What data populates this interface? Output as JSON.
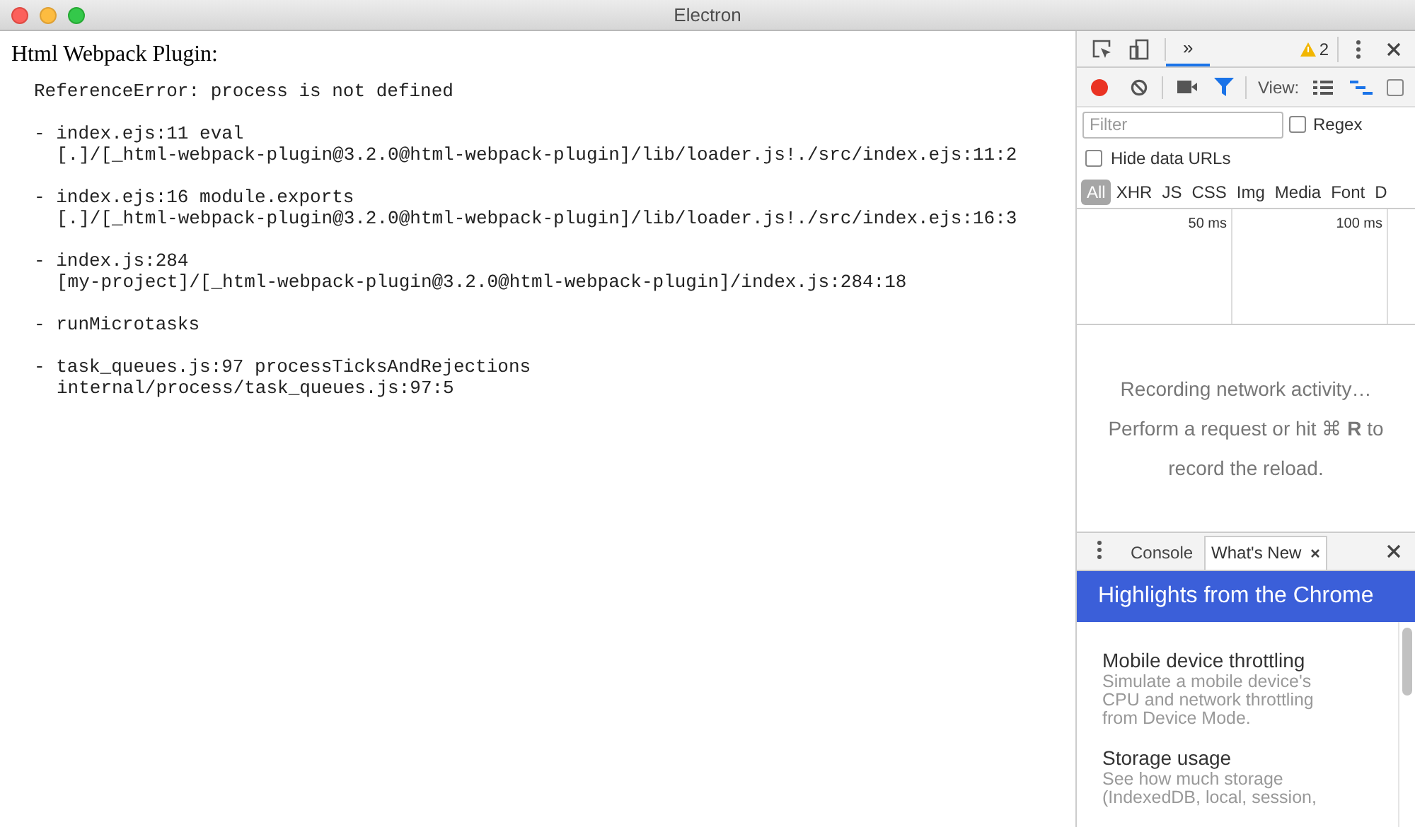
{
  "window": {
    "title": "Electron"
  },
  "page": {
    "heading": "Html Webpack Plugin:",
    "message": "ReferenceError: process is not defined",
    "frames": [
      {
        "call": "- index.ejs:11 eval",
        "location": "[.]/[_html-webpack-plugin@3.2.0@html-webpack-plugin]/lib/loader.js!./src/index.ejs:11:2"
      },
      {
        "call": "- index.ejs:16 module.exports",
        "location": "[.]/[_html-webpack-plugin@3.2.0@html-webpack-plugin]/lib/loader.js!./src/index.ejs:16:3"
      },
      {
        "call": "- index.js:284",
        "location": "[my-project]/[_html-webpack-plugin@3.2.0@html-webpack-plugin]/index.js:284:18"
      },
      {
        "call": "- runMicrotasks"
      },
      {
        "call": "- task_queues.js:97 processTicksAndRejections",
        "location": "internal/process/task_queues.js:97:5"
      }
    ]
  },
  "devtools": {
    "main_tabs": [
      {
        "label": "»",
        "selected": true
      }
    ],
    "warnings": "2",
    "network": {
      "view_label": "View:",
      "options_checkbox": {
        "checked": false
      },
      "recording": true,
      "filter": {
        "placeholder": "Filter"
      },
      "regex": {
        "label": "Regex",
        "checked": false
      },
      "hide_data_urls": {
        "label": "Hide data URLs",
        "checked": false
      },
      "types": [
        {
          "label": "All",
          "selected": true
        },
        {
          "label": "XHR",
          "selected": false
        },
        {
          "label": "JS",
          "selected": false
        },
        {
          "label": "CSS",
          "selected": false
        },
        {
          "label": "Img",
          "selected": false
        },
        {
          "label": "Media",
          "selected": false
        },
        {
          "label": "Font",
          "selected": false
        },
        {
          "label": "D",
          "selected": false
        }
      ],
      "timeline_ticks": [
        "50 ms",
        "100 ms"
      ],
      "empty_title": "Recording network activity…",
      "empty_hint": "Perform a request or hit ⌘ **R** to record the reload."
    },
    "drawer": {
      "tabs": [
        {
          "label": "Console",
          "selected": false,
          "closable": false
        },
        {
          "label": "What's New",
          "selected": true,
          "closable": true
        }
      ],
      "banner": "Highlights from the Chrome",
      "items": [
        {
          "title": "Mobile device throttling",
          "description": "Simulate a mobile device's CPU and network throttling from Device Mode."
        },
        {
          "title": "Storage usage",
          "description": "See how much storage (IndexedDB, local, session,"
        }
      ]
    }
  }
}
